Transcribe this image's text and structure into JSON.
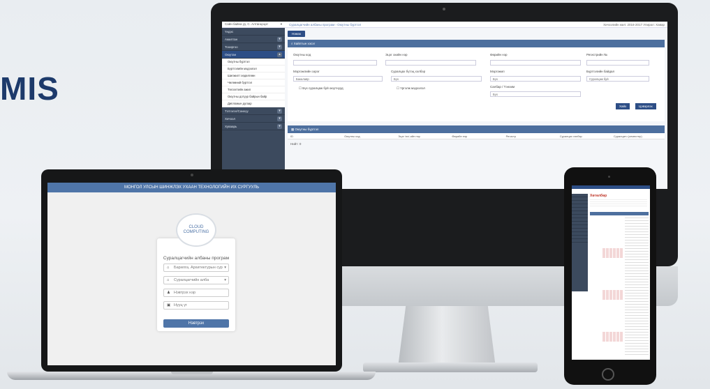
{
  "brand": "MIS",
  "desktop": {
    "user_select": "Сайн байна уу, С. Алтанцэцэг",
    "breadcrumb": "Суралцагчийн албаны програм › Оюутны бүртгэл",
    "top_right": "Хичээлийн жил: 2016-2017   Улирал: Хавар",
    "school_logo_text": "МОНГОЛ УЛСЫН ШИНЖЛЭХ УХААН ТЕХНОЛОГИЙН ИХ СУРГУУЛЬ",
    "sidebar": [
      {
        "label": "Үндэс"
      },
      {
        "label": "Ажилтан"
      },
      {
        "label": "Тохиргоо"
      },
      {
        "label": "Оюутан",
        "active": true
      }
    ],
    "sidebar_sub": [
      "Оюутны бүртгэл",
      "Бүртгэлийн мэдээлэл",
      "Шилжилт хөдөлгөөн",
      "Чөлөөний бүртгэл",
      "Төгсөлтийн ажил",
      "Оюутны дотуур байрын байр",
      "Дипломын дугаар"
    ],
    "sidebar_bottom": [
      "Тэтгэлэг/Санхүү",
      "Хичээл",
      "Хуваарь"
    ],
    "new_button": "Нэмэх",
    "filter_header": "Хайлтын хэсэг",
    "fields": {
      "code": "Оюутны код",
      "name": "Эцэг эхийн нэр",
      "surname": "Өөрийн нэр",
      "register": "Регистрийн №",
      "level": "Мэргэжлийн зэрэг",
      "level_val": "Бакалавр",
      "form": "Суралцах бүтэц хэлбэр",
      "form_val": "Бүх",
      "major": "Мэргэжил",
      "major_val": "Бүх",
      "status": "Бүртгэлийн байдал",
      "status_val": "Суралцаж буй",
      "class": "Салбар / Тэнхим",
      "class_val": "Бүх",
      "check1": "Бүх суралцаж буй оюутнууд",
      "check2": "Үргэлж мэдээлэл"
    },
    "search_button": "Хайх",
    "clear_button": "Цэвэрлэх",
    "table_header": "Оюутны бүртгэл",
    "columns": [
      "ID",
      "Оюутны код",
      "Эцэг /эх/-ийн нэр",
      "Өөрийн нэр",
      "Регистр",
      "Суралцах хэлбэр",
      "Суралцагч (семестер)"
    ],
    "footer_note": "Нийт: 0"
  },
  "laptop": {
    "header": "МОНГОЛ УЛСЫН ШИНЖЛЭХ УХААН ТЕХНОЛОГИЙН ИХ СУРГУУЛЬ",
    "cloud_text": "CLOUD COMPUTING",
    "title": "Суралцагчийн албаны програм",
    "school_select": "Барилга, Архитектурын сур",
    "role_select": "Суралцагчийн алба",
    "username_placeholder": "Нэвтрэх нэр",
    "password_placeholder": "Нууц үг",
    "login_button": "Нэвтрэх"
  },
  "tablet": {
    "title": "Хөтөлбөр"
  }
}
